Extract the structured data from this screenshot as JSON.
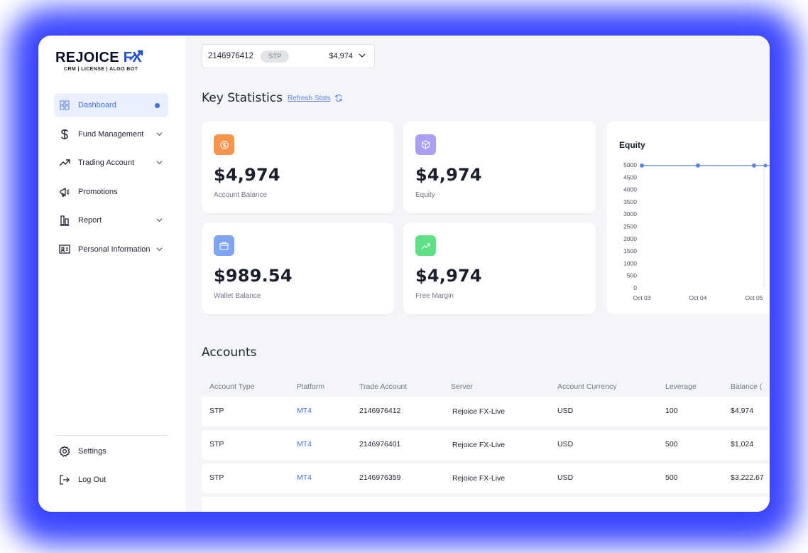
{
  "brand": {
    "name_main": "REJOICE",
    "name_accent": "FX",
    "tagline": "CRM | LICENSE | ALGO BOT",
    "accent_color": "#1d4ed8"
  },
  "sidebar": {
    "items": [
      {
        "label": "Dashboard",
        "icon": "grid-icon",
        "active": true
      },
      {
        "label": "Fund Management",
        "icon": "dollar-icon",
        "chevron": true
      },
      {
        "label": "Trading Account",
        "icon": "trend-up-icon",
        "chevron": true
      },
      {
        "label": "Promotions",
        "icon": "megaphone-icon"
      },
      {
        "label": "Report",
        "icon": "bar-chart-icon",
        "chevron": true
      },
      {
        "label": "Personal Information",
        "icon": "id-card-icon",
        "chevron": true
      }
    ],
    "bottom": [
      {
        "label": "Settings",
        "icon": "gear-icon"
      },
      {
        "label": "Log Out",
        "icon": "logout-icon"
      }
    ]
  },
  "account_selector": {
    "number": "2146976412",
    "type": "STP",
    "balance": "$4,974"
  },
  "key_statistics": {
    "title": "Key Statistics",
    "refresh_label": "Refresh Stats",
    "cards": [
      {
        "value": "$4,974",
        "label": "Account Balance",
        "icon": "dollar-icon",
        "color": "#f7944a"
      },
      {
        "value": "$4,974",
        "label": "Equity",
        "icon": "cube-icon",
        "color": "#a99ff5"
      },
      {
        "value": "$989.54",
        "label": "Wallet Balance",
        "icon": "wallet-icon",
        "color": "#7fa4f2"
      },
      {
        "value": "$4,974",
        "label": "Free Margin",
        "icon": "trend-up-icon",
        "color": "#5ee084"
      }
    ]
  },
  "chart_data": {
    "type": "line",
    "title": "Equity",
    "x": [
      "Oct 03",
      "Oct 04",
      "Oct 05"
    ],
    "series": [
      {
        "values": [
          4974,
          4974,
          4974
        ]
      }
    ],
    "ylim": [
      0,
      5000
    ],
    "yticks": [
      "5000",
      "4500",
      "4000",
      "3500",
      "3000",
      "2500",
      "2000",
      "1500",
      "1000",
      "500",
      "0"
    ],
    "color": "#5b84e6"
  },
  "accounts": {
    "title": "Accounts",
    "columns": [
      "Account Type",
      "Platform",
      "Trade Account",
      "Server",
      "Account Currency",
      "Leverage",
      "Balance ("
    ],
    "rows": [
      {
        "type": "STP",
        "platform": "MT4",
        "trade_account": "2146976412",
        "server": "Rejoice FX-Live",
        "currency": "USD",
        "leverage": "100",
        "balance": "$4,974"
      },
      {
        "type": "STP",
        "platform": "MT4",
        "trade_account": "2146976401",
        "server": "Rejoice FX-Live",
        "currency": "USD",
        "leverage": "500",
        "balance": "$1,024"
      },
      {
        "type": "STP",
        "platform": "MT4",
        "trade_account": "2146976359",
        "server": "Rejoice FX-Live",
        "currency": "USD",
        "leverage": "500",
        "balance": "$3,222.67"
      }
    ]
  }
}
